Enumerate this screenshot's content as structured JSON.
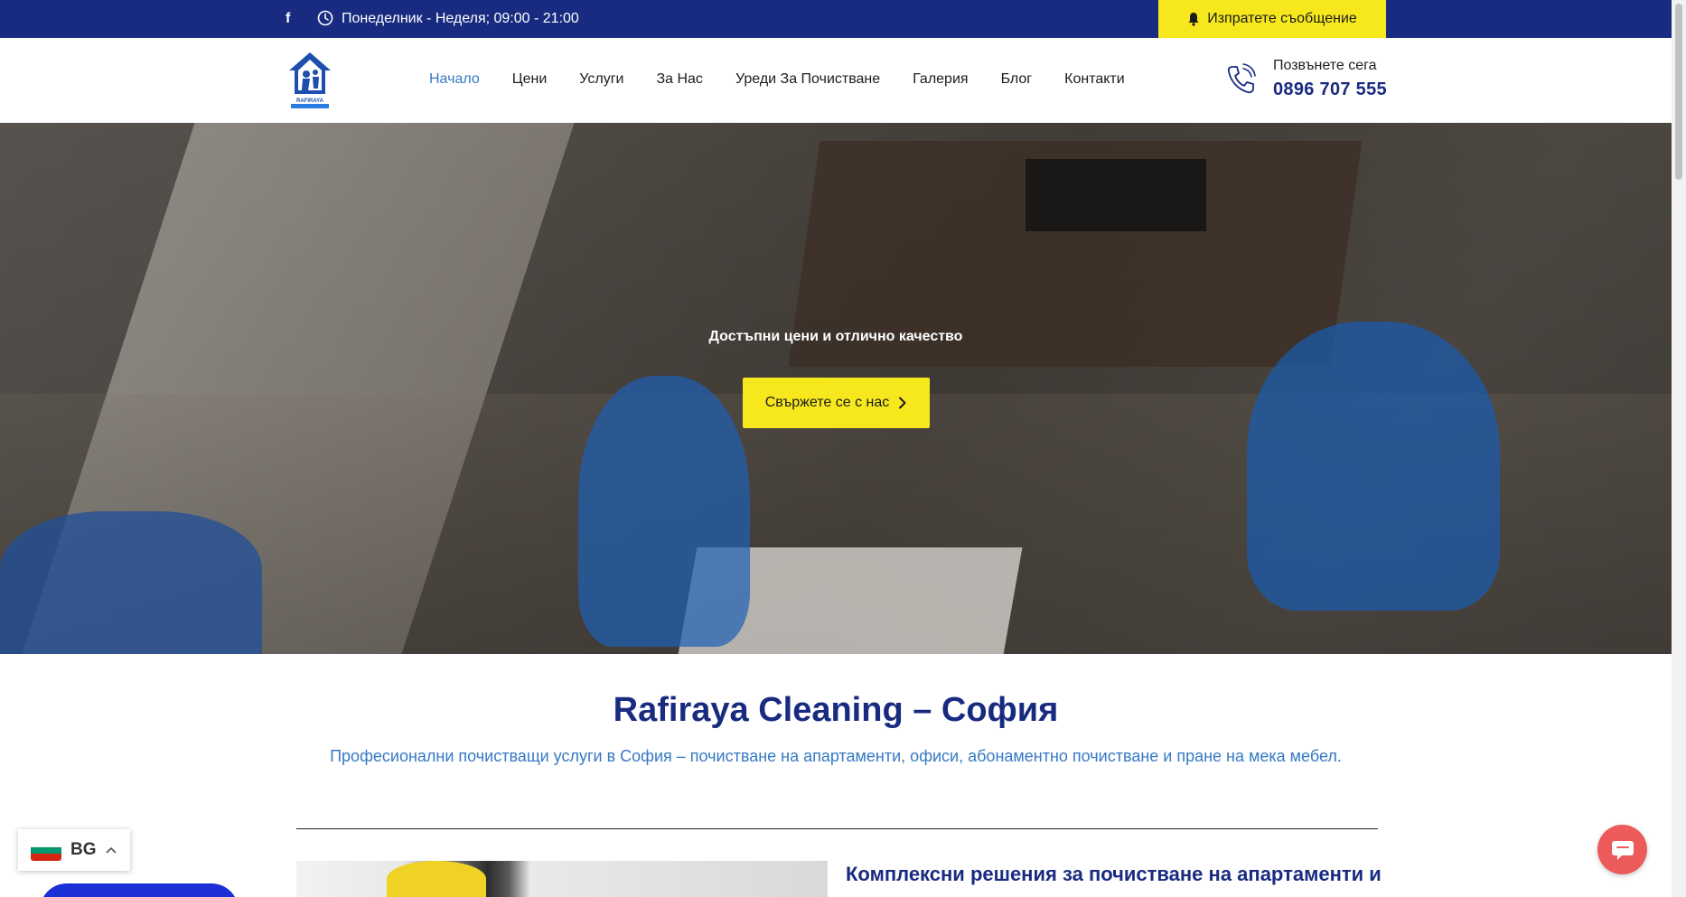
{
  "topbar": {
    "facebook_icon": "facebook-icon",
    "clock_icon": "clock-icon",
    "hours": "Понеделник - Неделя; 09:00 - 21:00",
    "message_button": "Изпратете съобщение",
    "bell_icon": "bell-icon"
  },
  "header": {
    "logo_text": "RAFIRAYA",
    "nav": [
      {
        "label": "Начало",
        "active": true
      },
      {
        "label": "Цени"
      },
      {
        "label": "Услуги"
      },
      {
        "label": "За Нас"
      },
      {
        "label": "Уреди За Почистване"
      },
      {
        "label": "Галерия"
      },
      {
        "label": "Блог"
      },
      {
        "label": "Контакти"
      }
    ],
    "call_label": "Позвънете сега",
    "call_number": "0896 707 555"
  },
  "hero": {
    "tagline": "Достъпни цени и отлично качество",
    "cta_label": "Свържете се с нас"
  },
  "content": {
    "title": "Rafiraya Cleaning – София",
    "subtitle": "Професионални почистващи услуги в София – почистване на апартаменти, офиси, абонаментно почистване и пране на мека мебел.",
    "section_heading": "Комплексни решения за почистване на апартаменти и"
  },
  "language": {
    "code": "BG"
  },
  "colors": {
    "brand_navy": "#182b80",
    "accent_yellow": "#f7e81d",
    "link_blue": "#3679c4",
    "chat_red": "#ec5a5a"
  }
}
